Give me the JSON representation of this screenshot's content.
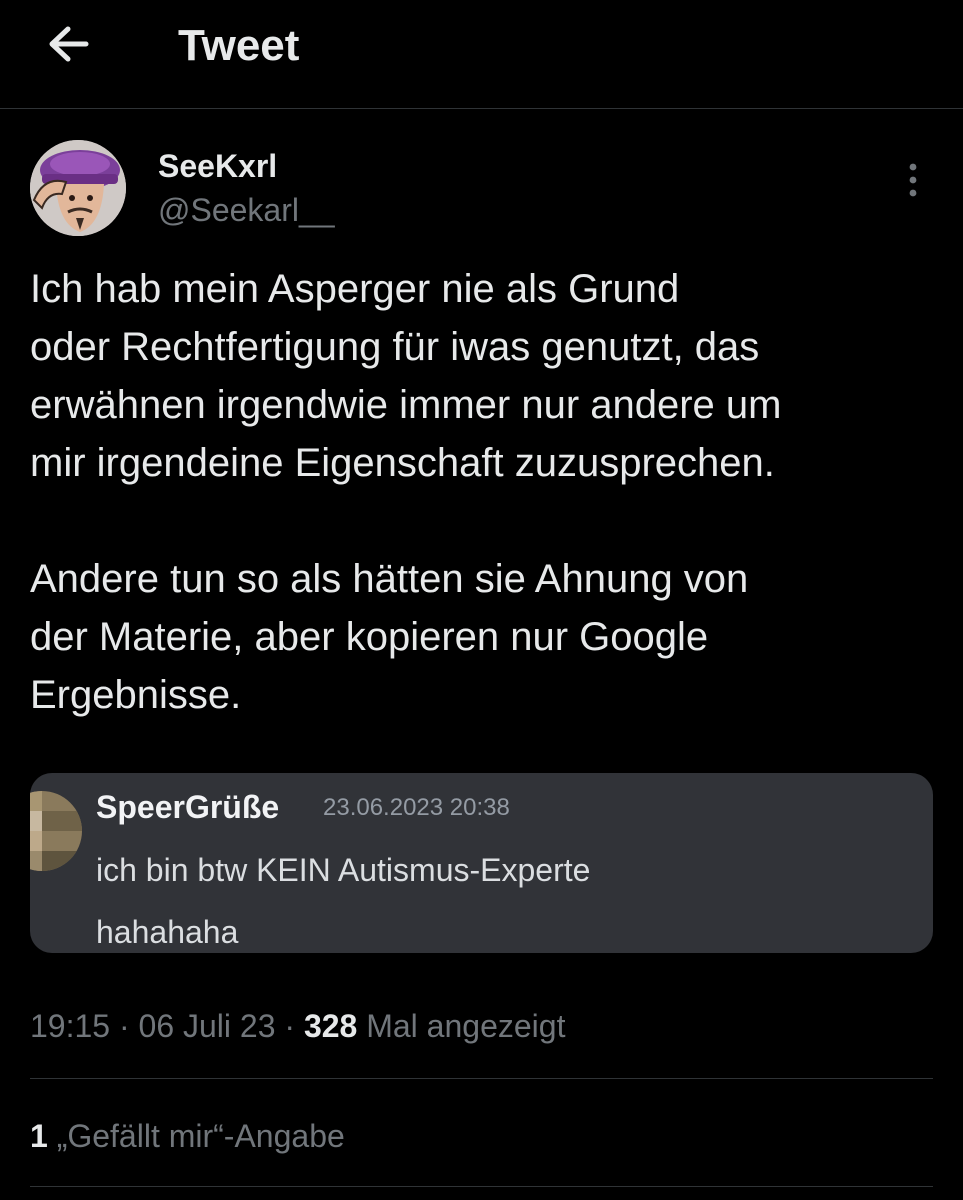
{
  "header": {
    "title": "Tweet",
    "back_icon": "arrow-left-icon"
  },
  "tweet": {
    "author": {
      "name": "SeeKxrl",
      "handle": "@Seekarl__",
      "avatar_icon": "avatar-cartoon-icon"
    },
    "more_icon": "more-vertical-icon",
    "text": {
      "paragraph_1": "Ich hab mein Asperger nie als Grund\noder Rechtfertigung für iwas genutzt, das\nerwähnen irgendwie immer nur andere um\nmir irgendeine Eigenschaft zuzusprechen.",
      "paragraph_2": "Andere tun so als hätten sie Ahnung von\nder Materie, aber kopieren nur Google\nErgebnisse."
    },
    "embedded_image": {
      "username": "SpeerGrüße",
      "timestamp": "23.06.2023 20:38",
      "message_line_1": "ich bin btw KEIN Autismus-Experte",
      "message_line_2": "hahahaha"
    },
    "meta": {
      "time": "19:15",
      "separator": "·",
      "date": "06 Juli 23",
      "views_count": "328",
      "views_label": "Mal angezeigt"
    },
    "likes": {
      "count": "1",
      "label": "„Gefällt mir“-Angabe"
    }
  },
  "colors": {
    "background": "#000000",
    "primary_text": "#e7e9ea",
    "secondary_text": "#71767b",
    "divider": "#2f3336",
    "embed_background": "#313338"
  }
}
